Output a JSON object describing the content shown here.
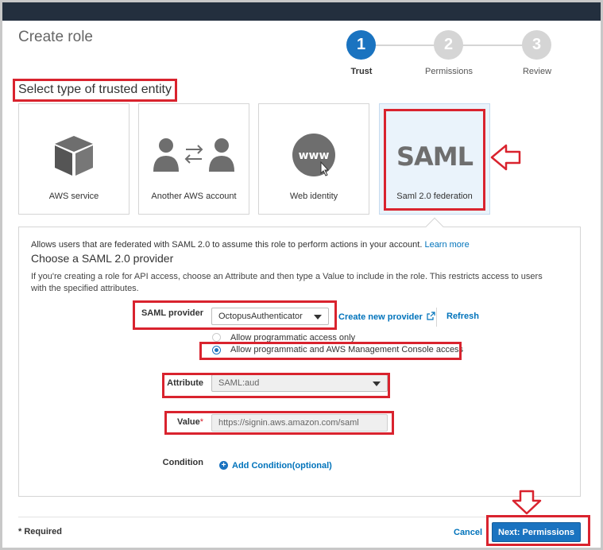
{
  "page": {
    "title": "Create role"
  },
  "steps": [
    {
      "number": "1",
      "label": "Trust",
      "active": true
    },
    {
      "number": "2",
      "label": "Permissions",
      "active": false
    },
    {
      "number": "3",
      "label": "Review",
      "active": false
    }
  ],
  "section_title": "Select type of trusted entity",
  "entity_cards": [
    {
      "label": "AWS service",
      "icon": "cube-icon"
    },
    {
      "label": "Another AWS account",
      "icon": "users-exchange-icon"
    },
    {
      "label": "Web identity",
      "icon": "www-globe-icon",
      "icon_text": "www"
    },
    {
      "label": "Saml 2.0 federation",
      "icon": "saml-logo-icon",
      "icon_text": "SAML",
      "selected": true
    }
  ],
  "panel": {
    "description": "Allows users that are federated with SAML 2.0 to assume this role to perform actions in your account.",
    "learn_more": "Learn more",
    "subtitle": "Choose a SAML 2.0 provider",
    "paragraph": "If you're creating a role for API access, choose an Attribute and then type a Value to include in the role. This restricts access to users with the specified attributes.",
    "saml_provider": {
      "label": "SAML provider",
      "value": "OctopusAuthenticator",
      "create_link": "Create new provider",
      "refresh": "Refresh"
    },
    "access_options": [
      {
        "label": "Allow programmatic access only",
        "checked": false
      },
      {
        "label": "Allow programmatic and AWS Management Console access",
        "checked": true
      }
    ],
    "attribute": {
      "label": "Attribute",
      "value": "SAML:aud"
    },
    "value_field": {
      "label": "Value",
      "required_mark": "*",
      "value": "https://signin.aws.amazon.com/saml"
    },
    "condition": {
      "label": "Condition",
      "add_link": "Add Condition(optional)"
    }
  },
  "footer": {
    "required": "* Required",
    "cancel": "Cancel",
    "next": "Next: Permissions"
  },
  "colors": {
    "primary": "#1a73c0",
    "link": "#0073bb",
    "highlight_box": "#d9232e",
    "topbar": "#232f3e"
  }
}
